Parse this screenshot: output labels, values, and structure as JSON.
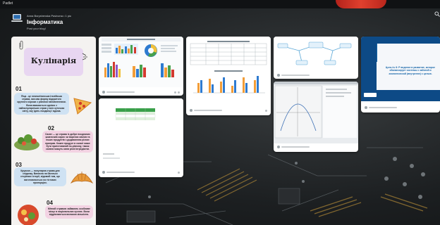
{
  "topbar": {
    "brand": "Padlet"
  },
  "header": {
    "owner": "Anna Boryshevska Pavlovna • 1 рік",
    "title": "Інформатика",
    "subtitle": "Post your blog!"
  },
  "infographic": {
    "title": "Кулінарія",
    "sections": [
      {
        "num": "01",
        "text": "Піца - це неаполітанська італійська страва, яка має форму відкритого круглого корожа з різними наповненнями. Вона вважається однією з найпопулярніших страв у всіх куточках світу, яку їдять поодинці і вдома."
      },
      {
        "num": "02",
        "text": "Салат — це страва із добре поєднаних шматочків сирих чи варених овочів та інших продуктів з додаванням різних приправ. Кожен продукт в салаті може бути приготований по-різному, також салати можуть мати різні інгредієнти."
      },
      {
        "num": "03",
        "text": "Круасан — популярна страва для сніданку. Виникла на багатьох сторінках історії, відомий тим, що виготовляється на тістових пропорціях."
      },
      {
        "num": "04",
        "text": "Мітний стравою займають особливе місце в національних кухнях. Вони відрізняються великою кількістю."
      }
    ]
  },
  "cards": [
    {
      "id": "dashboard"
    },
    {
      "id": "table-chart"
    },
    {
      "id": "diagram"
    },
    {
      "id": "presentation",
      "text": "Цель № 6: Р ведение в развитие, которое сбалансирует системы с заботой и экологической (внутренне) с целью."
    },
    {
      "id": "table-small"
    },
    {
      "id": "graph"
    }
  ],
  "colors": {
    "accent": "#1565a8",
    "header_text": "#ffffff"
  }
}
